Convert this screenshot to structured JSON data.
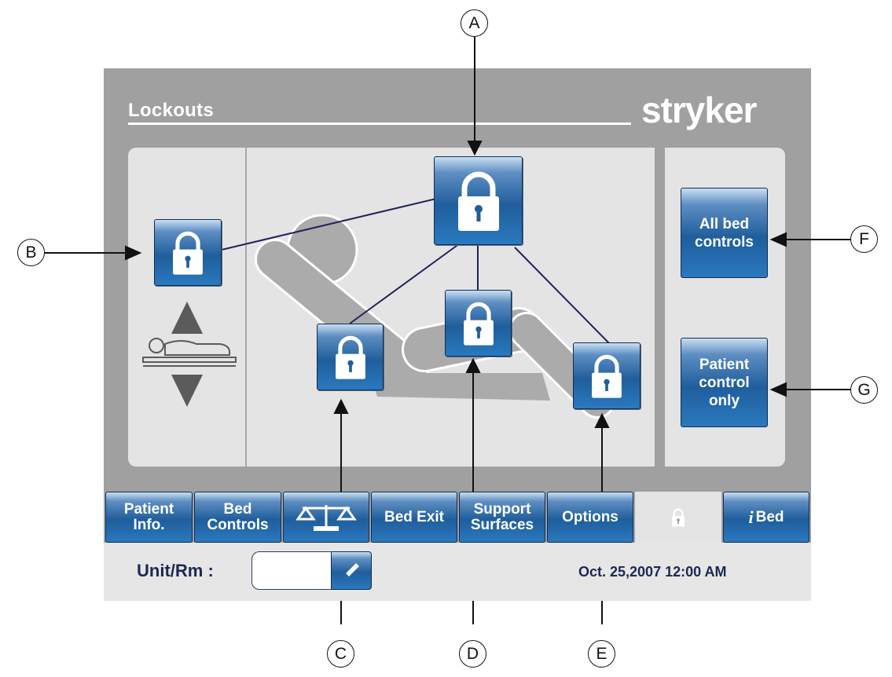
{
  "header": {
    "title": "Lockouts",
    "brand": "stryker"
  },
  "right_buttons": {
    "all_bed_controls": [
      "All bed",
      "controls"
    ],
    "patient_control_only": [
      "Patient",
      "control",
      "only"
    ]
  },
  "tabs": [
    {
      "lines": [
        "Patient",
        "Info."
      ]
    },
    {
      "lines": [
        "Bed",
        "Controls"
      ]
    },
    {
      "icon": "scale-icon"
    },
    {
      "lines": [
        "Bed Exit"
      ]
    },
    {
      "lines": [
        "Support",
        "Surfaces"
      ]
    },
    {
      "lines": [
        "Options"
      ]
    },
    {
      "icon": "lock-icon"
    },
    {
      "prefix": "i",
      "label": "Bed"
    }
  ],
  "status": {
    "unit_label": "Unit/Rm :",
    "unit_value": "",
    "datetime": "Oct. 25,2007  12:00 AM"
  },
  "callouts": {
    "A": "A",
    "B": "B",
    "C": "C",
    "D": "D",
    "E": "E",
    "F": "F",
    "G": "G"
  },
  "colors": {
    "screen_bg": "#a0a0a0",
    "panel_bg": "#e4e4e4",
    "button_blue": "#1f5e9c",
    "text_navy": "#1d2853"
  }
}
